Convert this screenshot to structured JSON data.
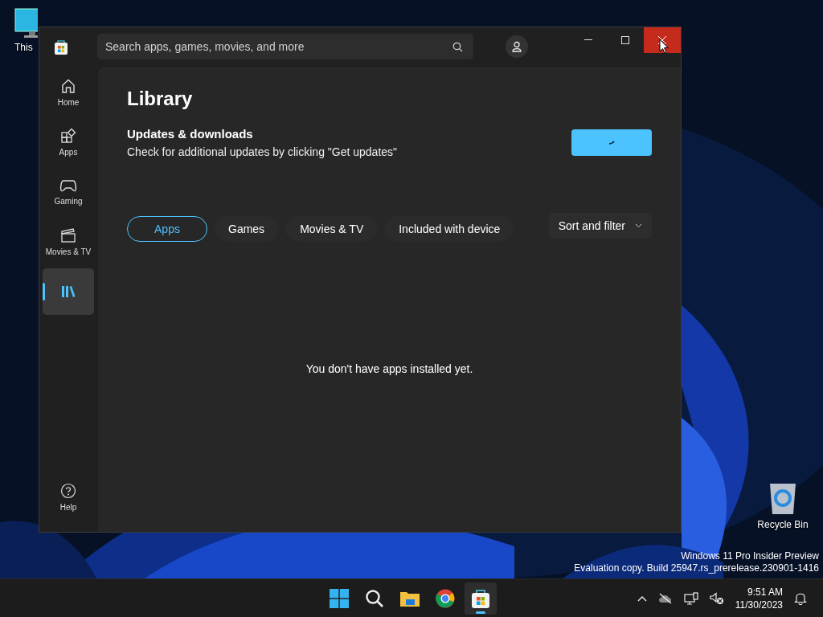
{
  "desktop": {
    "icons": [
      {
        "label": "This",
        "kind": "pc"
      },
      {
        "label": "Recycle Bin",
        "kind": "bin"
      }
    ],
    "watermark": [
      "Windows 11 Pro Insider Preview",
      "Evaluation copy. Build 25947.rs_prerelease.230901-1416"
    ]
  },
  "window": {
    "search": {
      "placeholder": "Search apps, games, movies, and more"
    },
    "nav": [
      {
        "label": "Home",
        "kind": "home",
        "selected": false
      },
      {
        "label": "Apps",
        "kind": "apps",
        "selected": false
      },
      {
        "label": "Gaming",
        "kind": "gaming",
        "selected": false
      },
      {
        "label": "Movies & TV",
        "kind": "movies",
        "selected": false
      },
      {
        "kind": "library",
        "selected": true
      }
    ],
    "help": {
      "label": "Help"
    },
    "title": "Library",
    "updates": {
      "heading": "Updates & downloads",
      "text": "Check for additional updates by clicking \"Get updates\""
    },
    "filters": [
      {
        "label": "Apps",
        "selected": true
      },
      {
        "label": "Games",
        "selected": false
      },
      {
        "label": "Movies & TV",
        "selected": false
      },
      {
        "label": "Included with device",
        "selected": false
      }
    ],
    "sort": "Sort and filter",
    "empty": "You don't have apps installed yet."
  },
  "taskbar": {
    "apps": [
      {
        "kind": "start",
        "active": false
      },
      {
        "kind": "search",
        "active": false
      },
      {
        "kind": "folder",
        "active": false
      },
      {
        "kind": "browser",
        "active": false
      },
      {
        "kind": "store",
        "active": true
      }
    ],
    "time": "9:51 AM",
    "date": "11/30/2023"
  }
}
